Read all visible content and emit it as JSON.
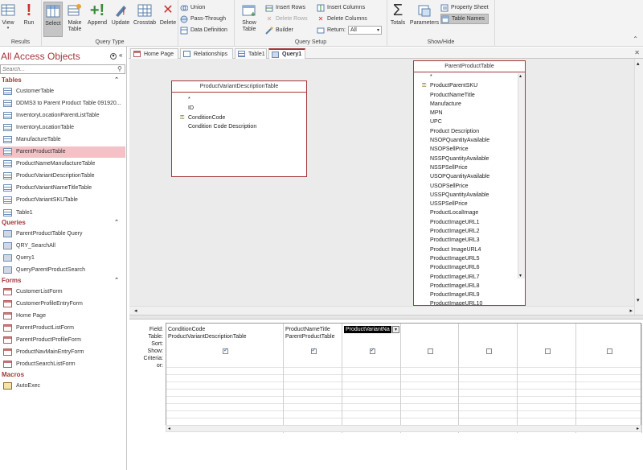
{
  "ribbon": {
    "results": {
      "label": "Results",
      "view": "View",
      "run": "Run"
    },
    "query_type": {
      "label": "Query Type",
      "select": "Select",
      "make_table": "Make Table",
      "append": "Append",
      "update": "Update",
      "crosstab": "Crosstab",
      "delete": "Delete",
      "union": "Union",
      "pass_through": "Pass-Through",
      "data_definition": "Data Definition"
    },
    "query_setup": {
      "label": "Query Setup",
      "show_table": "Show Table",
      "insert_rows": "Insert Rows",
      "delete_rows": "Delete Rows",
      "builder": "Builder",
      "insert_columns": "Insert Columns",
      "delete_columns": "Delete Columns",
      "return_label": "Return:",
      "return_value": "All"
    },
    "show_hide": {
      "label": "Show/Hide",
      "totals": "Totals",
      "parameters": "Parameters",
      "property_sheet": "Property Sheet",
      "table_names": "Table Names"
    }
  },
  "nav": {
    "title": "All Access Objects",
    "search_placeholder": "Search...",
    "sections": {
      "tables": "Tables",
      "queries": "Queries",
      "forms": "Forms",
      "macros": "Macros"
    },
    "tables": [
      "CustomerTable",
      "DDMS3 to Parent Product Table 091920...",
      "InventoryLocationParentListTable",
      "InventoryLocationTable",
      "ManufactureTable",
      "ParentProductTable",
      "ProductNameManufactureTable",
      "ProductVariantDescriptionTable",
      "ProductVariantNameTitleTable",
      "ProductVariantSKUTable",
      "Table1"
    ],
    "queries": [
      "ParentProductTable Query",
      "QRY_SearchAll",
      "Query1",
      "QueryParentProductSearch"
    ],
    "forms": [
      "CustomerListForm",
      "CustomerProfileEntryForm",
      "Home Page",
      "ParentProductListForm",
      "ParentProductProfileForm",
      "ProductNavMainEntryForm",
      "ProductSearchListForm"
    ],
    "macros": [
      "AutoExec"
    ]
  },
  "tabs": [
    "Home Page",
    "Relationships",
    "Table1",
    "Query1"
  ],
  "design": {
    "variant_table": {
      "title": "ProductVariantDescriptionTable",
      "fields": [
        "*",
        "ID",
        "ConditionCode",
        "Condition Code Description"
      ]
    },
    "parent_table": {
      "title": "ParentProductTable",
      "fields": [
        "*",
        "ProductParentSKU",
        "ProductNameTitle",
        "Manufacture",
        "MPN",
        "UPC",
        "Product Description",
        "NSOPQuantityAvailable",
        "NSOPSellPrice",
        "NSSPQuantityAvailable",
        "NSSPSellPrice",
        "USOPQuantityAvailable",
        "USOPSellPrice",
        "USSPQuantityAvailable",
        "USSPSellPrice",
        "ProductLocalImage",
        "ProductImageURL1",
        "ProductImageURL2",
        "ProductImageURL3",
        "Product ImageURL4",
        "ProductImageURL5",
        "ProductImageURL6",
        "ProductImageURL7",
        "ProductImageURL8",
        "ProductImageURL9",
        "ProductImageURL10"
      ]
    }
  },
  "grid": {
    "row_labels": [
      "Field:",
      "Table:",
      "Sort:",
      "Show:",
      "Criteria:",
      "or:"
    ],
    "columns": [
      {
        "field": "ConditionCode",
        "table": "ProductVariantDescriptionTable",
        "show": true
      },
      {
        "field": "ProductNameTitle",
        "table": "ParentProductTable",
        "show": true
      },
      {
        "field": "ProductVariantNa",
        "table": "",
        "show": true
      },
      {
        "field": "",
        "table": "",
        "show": false
      },
      {
        "field": "",
        "table": "",
        "show": false
      },
      {
        "field": "",
        "table": "",
        "show": false
      },
      {
        "field": "",
        "table": "",
        "show": false
      },
      {
        "field": "",
        "table": "",
        "show": false
      }
    ]
  }
}
